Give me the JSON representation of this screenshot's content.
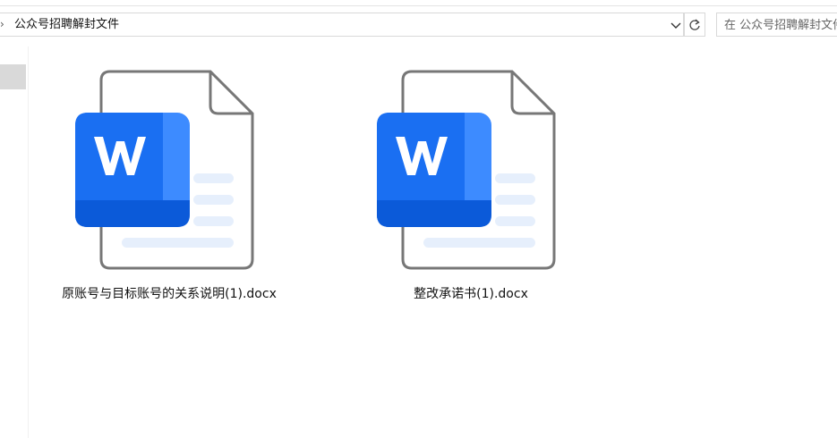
{
  "addressbar": {
    "path": "公众号招聘解封文件"
  },
  "search": {
    "placeholder": "在 公众号招聘解封文件 中搜索"
  },
  "files": [
    {
      "name": "原账号与目标账号的关系说明(1).docx",
      "icon": "word-document-icon"
    },
    {
      "name": "整改承诺书(1).docx",
      "icon": "word-document-icon"
    }
  ],
  "colors": {
    "word_blue": "#1a6ff2",
    "word_blue_light": "#3d8bff",
    "word_blue_dark": "#0b5ad9",
    "doc_outline": "#777777",
    "doc_lines": "#e6effc"
  }
}
